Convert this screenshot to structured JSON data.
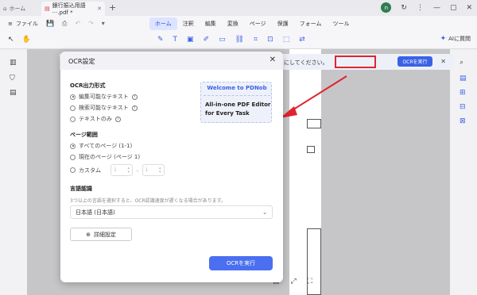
{
  "titlebar": {
    "home_label": "ホーム",
    "doc_tab": "銀行振込用語···.pdf *",
    "avatar_letter": "n"
  },
  "menubar": {
    "file_label": "ファイル",
    "tabs": [
      "ホーム",
      "注釈",
      "編集",
      "変換",
      "ページ",
      "保護",
      "フォーム",
      "ツール"
    ],
    "active_tab": "ホーム"
  },
  "toolbar": {
    "ai_label": "AIに質問"
  },
  "notice": {
    "text": "にしてください。",
    "button": "OCRを実行"
  },
  "dialog": {
    "title": "OCR設定",
    "output_format": {
      "title": "OCR出力形式",
      "options": [
        "編集可能なテキスト",
        "検索可能なテキスト",
        "テキストのみ"
      ],
      "selected": 0
    },
    "page_range": {
      "title": "ページ範囲",
      "options": [
        "すべてのページ (1-1)",
        "現在のページ (ページ 1)",
        "カスタム"
      ],
      "selected": 0,
      "from": "1",
      "to": "1"
    },
    "language": {
      "title": "言語認識",
      "hint": "3つ以上の言語を選択すると、OCR認識速度が遅くなる場合があります。",
      "selected": "日本語 (日本語)"
    },
    "advanced_button": "詳細設定",
    "run_button": "OCRを実行",
    "promo": {
      "headline": "Welcome to PDNob",
      "line1": "All-in-one PDF Editor",
      "line2": "for Every Task"
    }
  },
  "colors": {
    "accent": "#3b62e6",
    "annotation": "#e0242f"
  }
}
